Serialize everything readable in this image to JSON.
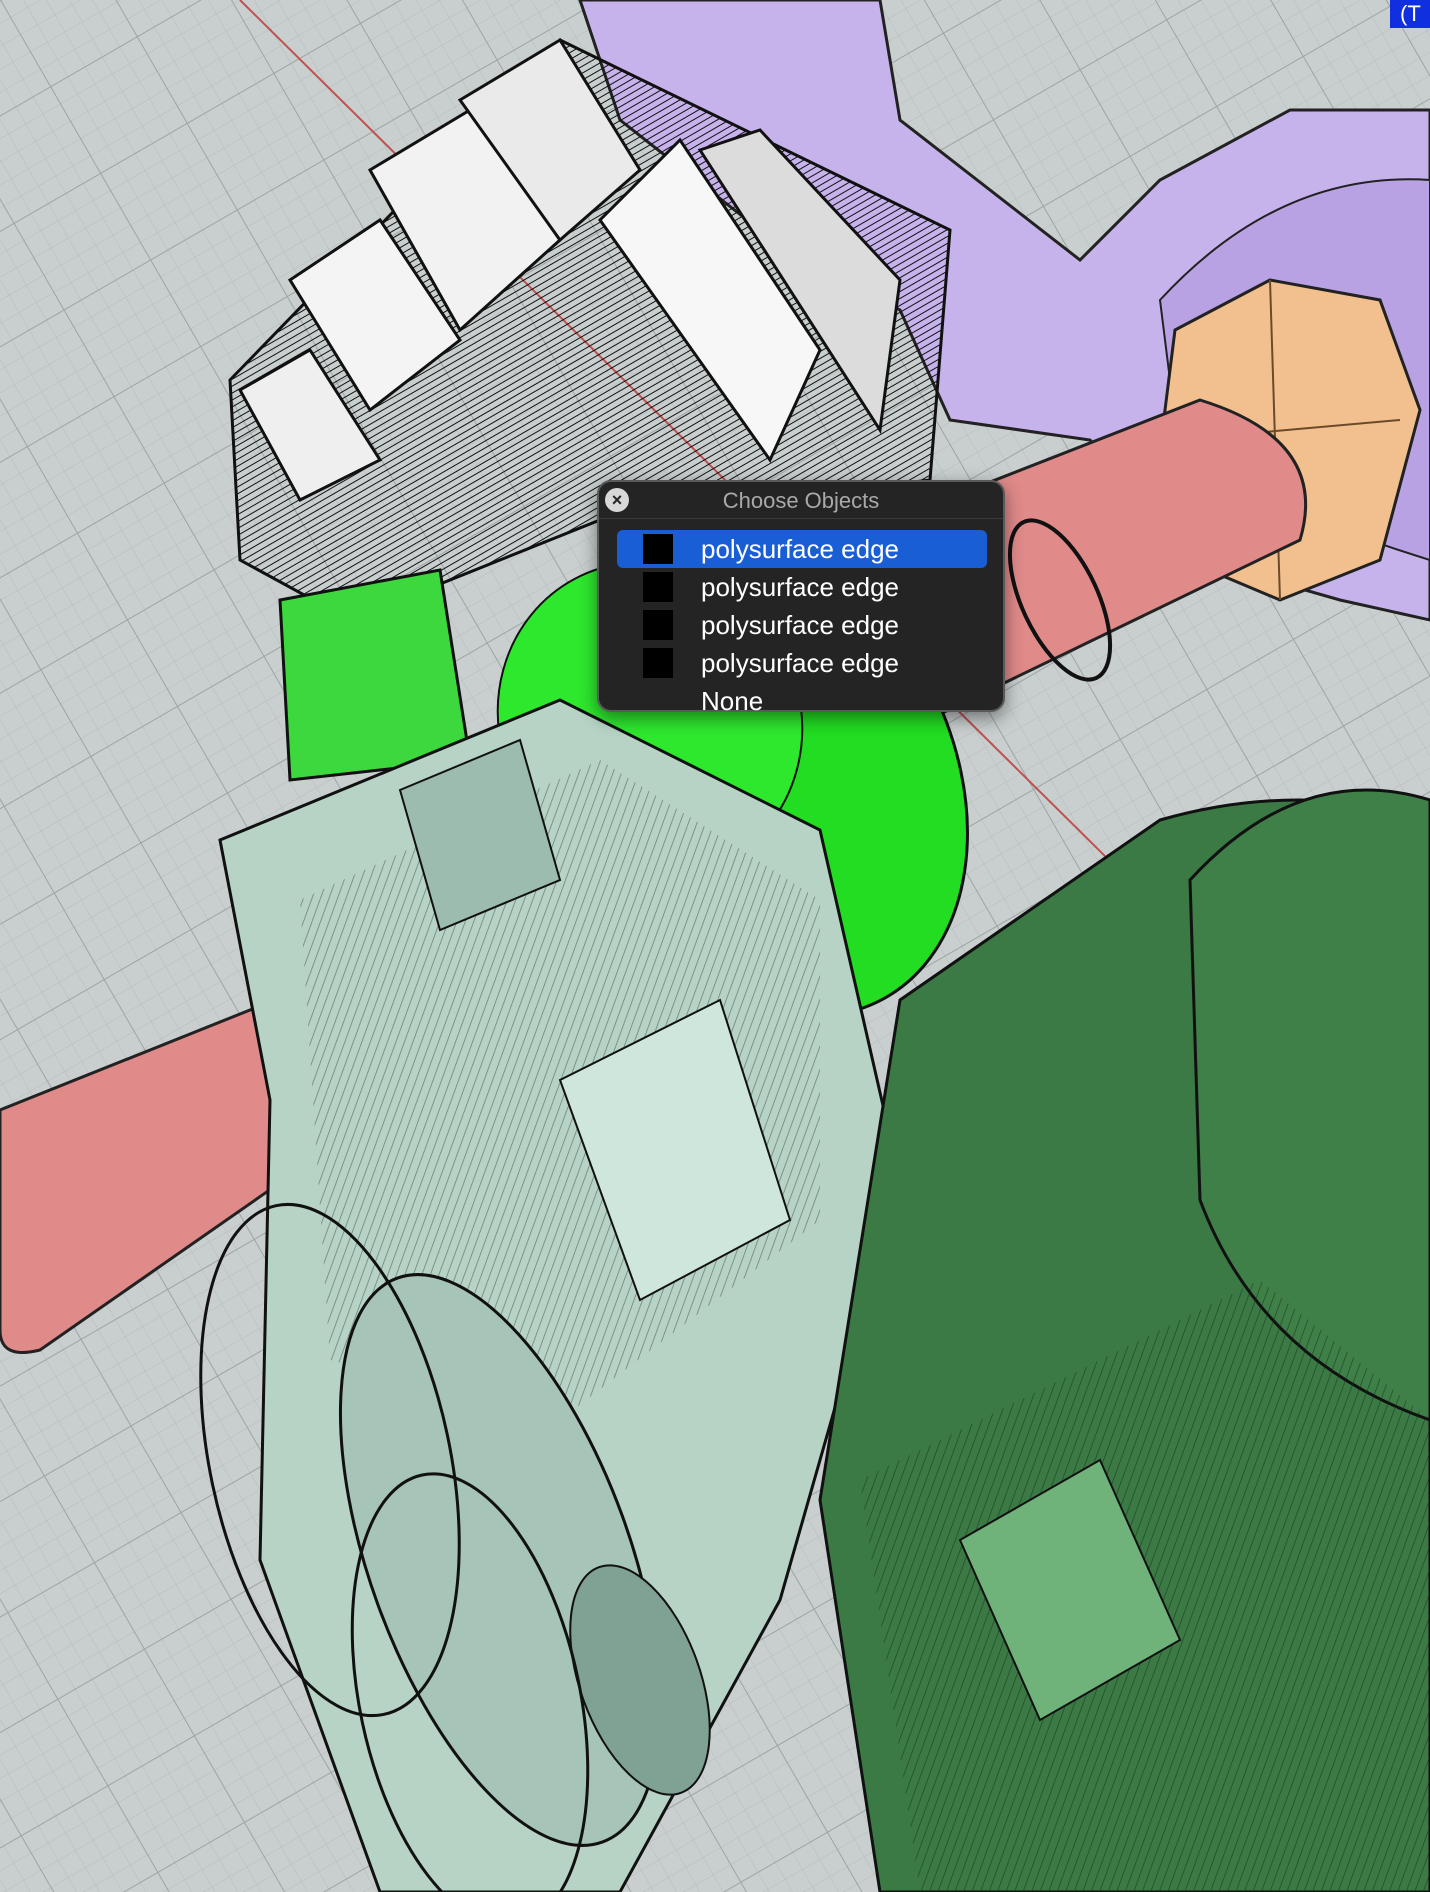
{
  "viewport": {
    "corner_tag": "(T"
  },
  "popup": {
    "title": "Choose Objects",
    "close_icon": "close-circle-icon",
    "items": [
      {
        "label": "polysurface edge",
        "swatch_color": "#000000",
        "selected": true
      },
      {
        "label": "polysurface edge",
        "swatch_color": "#000000",
        "selected": false
      },
      {
        "label": "polysurface edge",
        "swatch_color": "#000000",
        "selected": false
      },
      {
        "label": "polysurface edge",
        "swatch_color": "#000000",
        "selected": false
      },
      {
        "label": "None",
        "selected": false
      }
    ]
  },
  "colors": {
    "selection": "#1a5ed6",
    "highlight_green": "#22dd22",
    "shaft": "#e08a8a",
    "nut": "#f2c08e",
    "bracket": "#c7b3ec",
    "gear_light": "#b6d3c6",
    "gear_dark": "#3b7a45",
    "grid_bg": "#c9cfcf"
  }
}
